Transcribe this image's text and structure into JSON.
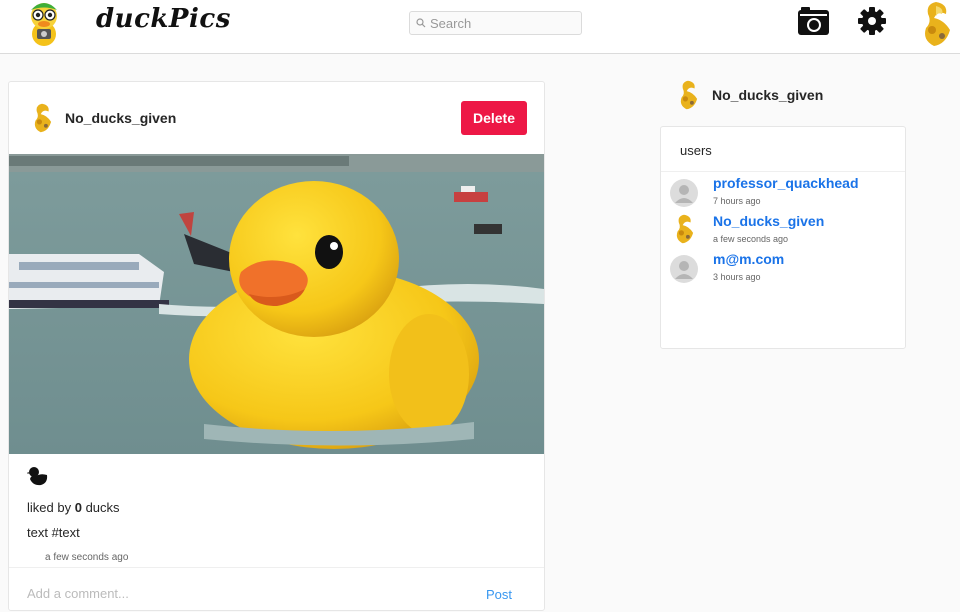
{
  "header": {
    "brand": "duckPics",
    "search_placeholder": "Search"
  },
  "post": {
    "username": "No_ducks_given",
    "delete_label": "Delete",
    "likes_prefix": "liked by",
    "likes_count": "0",
    "likes_suffix": "ducks",
    "caption": "text #text",
    "timestamp": "a few seconds ago",
    "comment_placeholder": "Add a comment...",
    "post_label": "Post"
  },
  "sidebar": {
    "current_user": "No_ducks_given",
    "users_title": "users",
    "users": [
      {
        "name": "professor_quackhead",
        "time": "7 hours ago"
      },
      {
        "name": "No_ducks_given",
        "time": "a few seconds ago"
      },
      {
        "name": "m@m.com",
        "time": "3 hours ago"
      }
    ]
  },
  "colors": {
    "delete": "#ed1846",
    "link": "#3897f0",
    "user_link": "#1a73e8"
  }
}
